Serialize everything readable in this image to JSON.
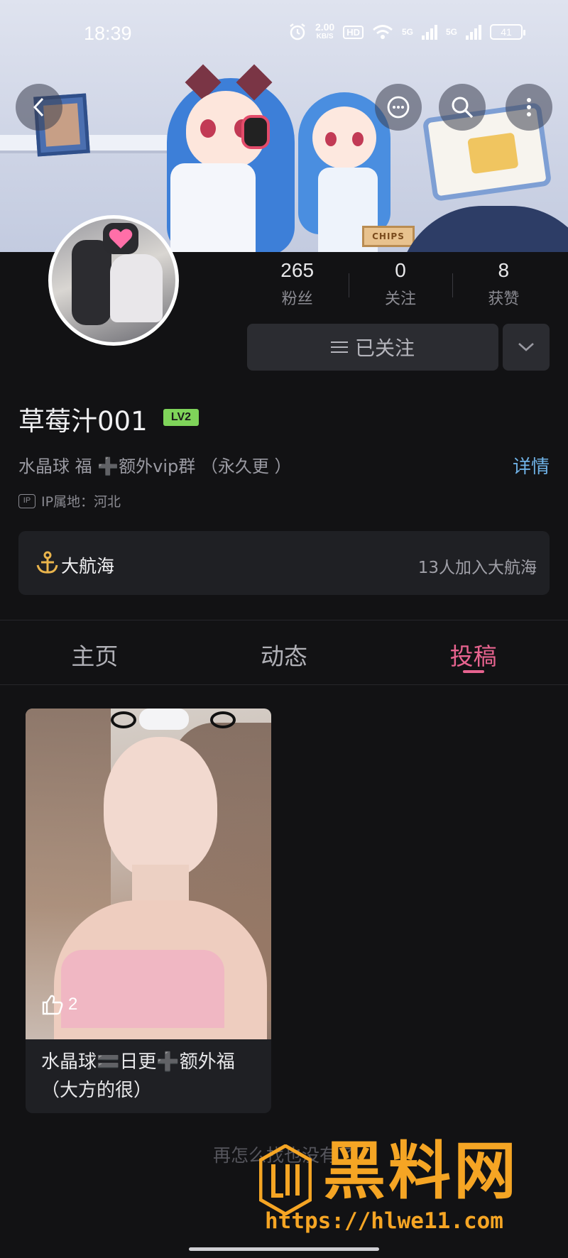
{
  "status_bar": {
    "time": "18:39",
    "net_speed_value": "2.00",
    "net_speed_unit": "KB/S",
    "hd": "HD",
    "sig1_label": "5G",
    "sig2_label": "5G",
    "battery": "41"
  },
  "profile": {
    "stats": [
      {
        "value": "265",
        "label": "粉丝"
      },
      {
        "value": "0",
        "label": "关注"
      },
      {
        "value": "8",
        "label": "获赞"
      }
    ],
    "follow_label": "已关注",
    "name": "草莓汁001",
    "level": "LV2",
    "bio": "水晶球 福 ➕额外vip群 （永久更 ）",
    "detail_link": "详情",
    "ip_icon": "IP",
    "ip_text": "IP属地：河北"
  },
  "fleet": {
    "title": "大航海",
    "count_text": "13人加入大航海"
  },
  "banner": {
    "chips_text": "CHIPS"
  },
  "tabs": [
    {
      "label": "主页",
      "active": false
    },
    {
      "label": "动态",
      "active": false
    },
    {
      "label": "投稿",
      "active": true
    }
  ],
  "videos": [
    {
      "likes": "2",
      "title": "水晶球🟰日更➕额外福（大方的很）"
    }
  ],
  "end_text": "再怎么找也没有了",
  "watermark": {
    "name": "黑料网",
    "url": "https://hlwe11.com"
  },
  "colors": {
    "accent": "#e7638f",
    "link": "#6fb2e6",
    "level_badge": "#7fd45a",
    "watermark": "#f5a524",
    "background": "#121214"
  }
}
